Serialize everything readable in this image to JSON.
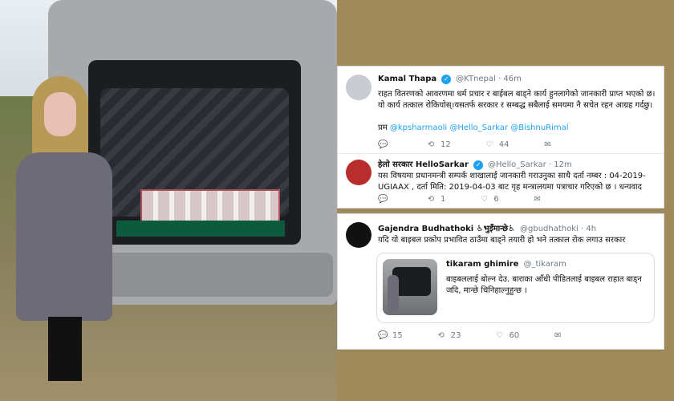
{
  "left_photo": {
    "scene": "Woman standing beside an open SUV trunk filled with packaged items and stacked boxes"
  },
  "tweets": [
    {
      "name": "Kamal Thapa",
      "handle": "@KTnepal · 46m",
      "text": "राहत वितरणको आवरणमा धर्म प्रचार र बाईबल बाड्ने कार्य हुनलागेको जानकारी प्राप्त भएको छ।यो कार्य तत्काल रोकियोस्।यसतर्फ सरकार र सम्बद्ध सबैलाई समयमा नै सचेत रहन आग्रह गर्दछु।",
      "mentions_prefix": "प्रम",
      "mentions": "@kpsharmaoli @Hello_Sarkar @BishnuRimal",
      "actions": {
        "reply": "",
        "retweet": "12",
        "like": "44",
        "dm": ""
      }
    },
    {
      "name": "हेलो सरकार HelloSarkar",
      "handle": "@Hello_Sarkar · 12m",
      "text": "यस विषयमा प्रधानमन्त्री सम्पर्क शाखालाई जानकारी गराउनुका साथै दर्ता नम्बर : 04-2019-UGIAAX , दर्ता मिति: 2019-04-03 बाट गृह मन्त्रालयमा पत्राचार गरिएको छ । धन्यवाद",
      "actions": {
        "reply": "",
        "retweet": "1",
        "like": "6",
        "dm": ""
      }
    },
    {
      "name": "Gajendra Budhathoki ♿भुइँमान्छे♿",
      "handle": "@gbudhathoki · 4h",
      "text": "यदि यो बाइबल प्रकोप प्रभावित ठाउँमा बाड्ने तयारी हो भने तत्काल रोक लगाउ सरकार",
      "quote": {
        "name": "tikaram ghimire",
        "handle": "@_tikaram",
        "text": "बाइबललाई बोल्न देउ. बाराका आँधी पीडितलाई बाइबल राहात बाड्न जदि, मान्छे चिनिहाल्नुहुन्छ ।"
      },
      "actions": {
        "reply": "15",
        "retweet": "23",
        "like": "60",
        "dm": ""
      }
    }
  ],
  "icons": {
    "reply": "reply-icon",
    "retweet": "retweet-icon",
    "like": "heart-icon",
    "dm": "mail-icon",
    "verified": "verified-icon"
  },
  "colors": {
    "background": "#a08a5a",
    "link": "#1da1f2",
    "secondary_text": "#6b7a87"
  }
}
